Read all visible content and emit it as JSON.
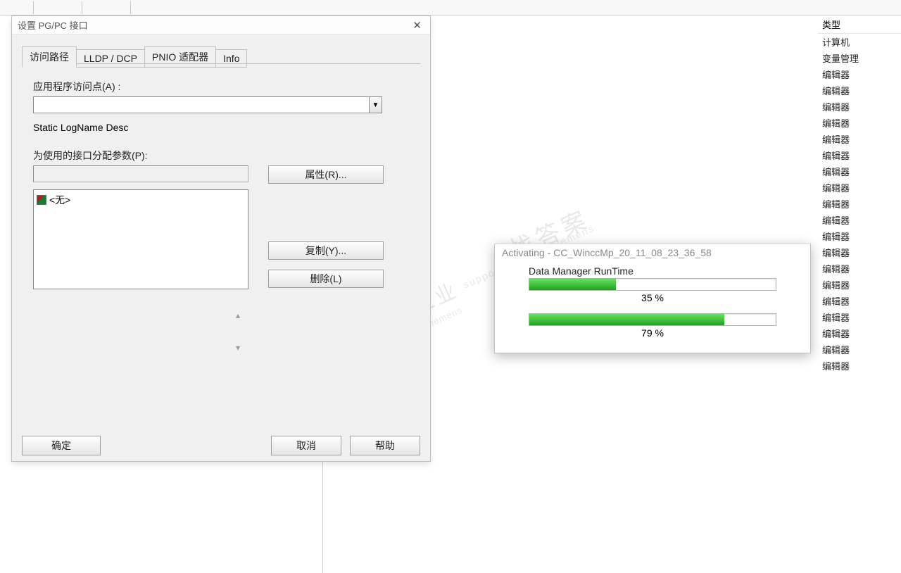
{
  "type_column": {
    "header": "类型",
    "rows": [
      "计算机",
      "变量管理",
      "编辑器",
      "编辑器",
      "编辑器",
      "编辑器",
      "编辑器",
      "编辑器",
      "编辑器",
      "编辑器",
      "编辑器",
      "编辑器",
      "编辑器",
      "编辑器",
      "编辑器",
      "编辑器",
      "编辑器",
      "编辑器",
      "编辑器",
      "编辑器",
      "编辑器"
    ]
  },
  "dialog": {
    "title": "设置 PG/PC 接口",
    "tabs": {
      "t0": "访问路径",
      "t1": "LLDP / DCP",
      "t2": "PNIO 适配器",
      "t3": "Info"
    },
    "access_point_label": "应用程序访问点(A) :",
    "access_point_value": "",
    "static_desc": "Static LogName Desc",
    "param_label": "为使用的接口分配参数(P):",
    "param_value": "",
    "list_item0": "<无>",
    "btn_props": "属性(R)...",
    "btn_copy": "复制(Y)...",
    "btn_del": "删除(L)",
    "btn_ok": "确定",
    "btn_cancel": "取消",
    "btn_help": "帮助"
  },
  "progress": {
    "title": "Activating - CC_WinccMp_20_11_08_23_36_58",
    "task": "Data Manager RunTime",
    "pct1": 35,
    "pct1_label": "35 %",
    "pct2": 79,
    "pct2_label": "79 %"
  },
  "watermark": {
    "a": "找答案",
    "b": "support.industry.siemens",
    "c": "西门子工业",
    "d": "support.industry.siemens"
  }
}
